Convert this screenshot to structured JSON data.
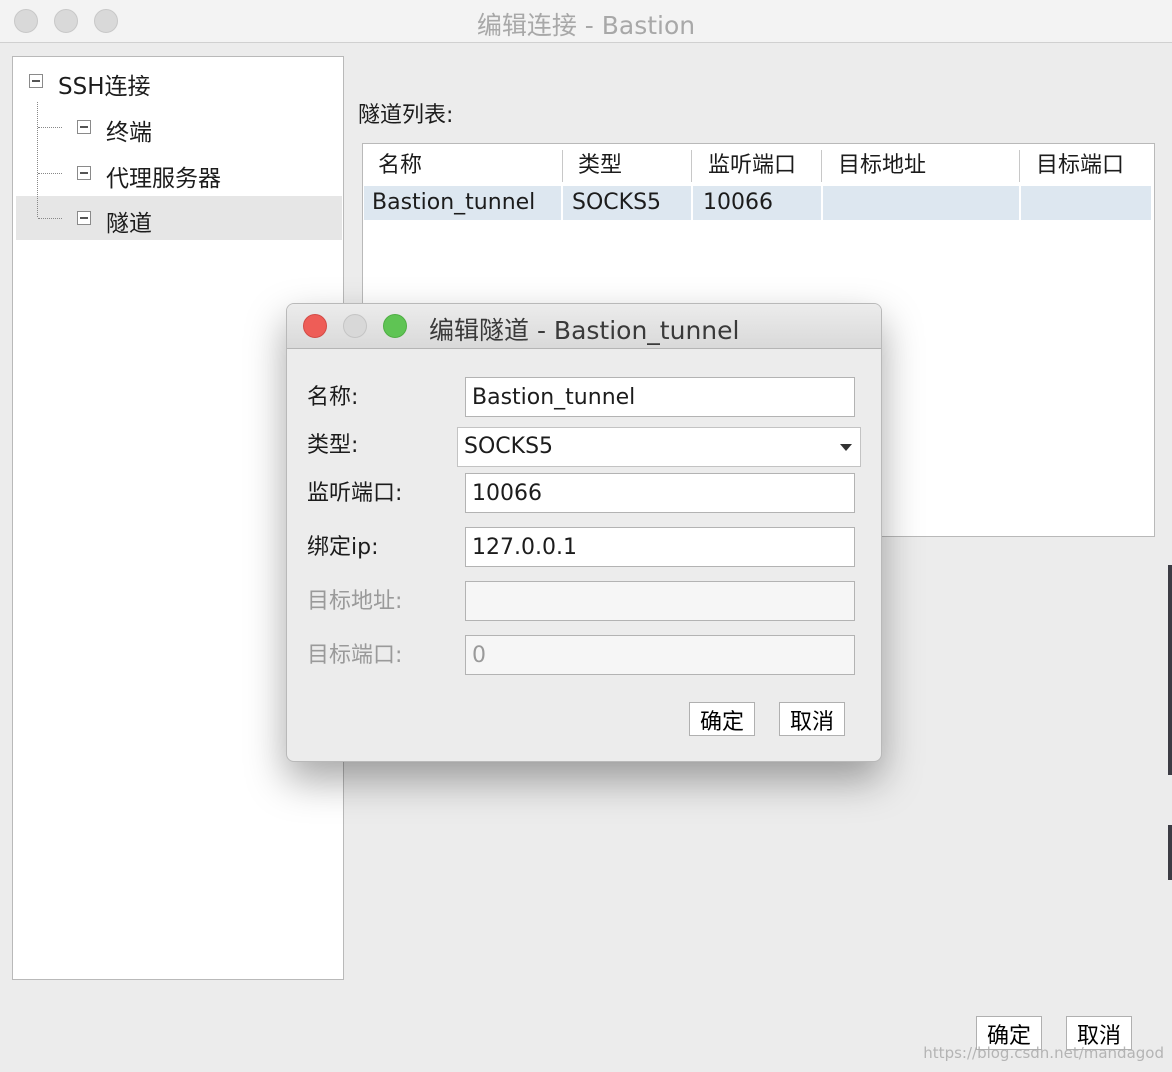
{
  "window": {
    "title": "编辑连接 - Bastion"
  },
  "tree": {
    "root": {
      "label": "SSH连接"
    },
    "children": [
      {
        "label": "终端"
      },
      {
        "label": "代理服务器"
      },
      {
        "label": "隧道",
        "selected": true
      }
    ]
  },
  "tunnel_list": {
    "label": "隧道列表:",
    "columns": [
      "名称",
      "类型",
      "监听端口",
      "目标地址",
      "目标端口"
    ],
    "rows": [
      {
        "name": "Bastion_tunnel",
        "type": "SOCKS5",
        "listen_port": "10066",
        "target_address": "",
        "target_port": ""
      }
    ]
  },
  "footer": {
    "ok_label": "确定",
    "cancel_label": "取消"
  },
  "watermark": "https://blog.csdn.net/mandagod",
  "dialog": {
    "title": "编辑隧道 - Bastion_tunnel",
    "fields": {
      "name": {
        "label": "名称:",
        "value": "Bastion_tunnel"
      },
      "type": {
        "label": "类型:",
        "value": "SOCKS5"
      },
      "listen_port": {
        "label": "监听端口:",
        "value": "10066"
      },
      "bind_ip": {
        "label": "绑定ip:",
        "value": "127.0.0.1"
      },
      "target_address": {
        "label": "目标地址:",
        "value": ""
      },
      "target_port": {
        "label": "目标端口:",
        "value": "0"
      }
    },
    "ok_label": "确定",
    "cancel_label": "取消"
  },
  "colors": {
    "close": "#ee5d57",
    "zoom": "#5fc454",
    "selection": "#dde7f0"
  }
}
